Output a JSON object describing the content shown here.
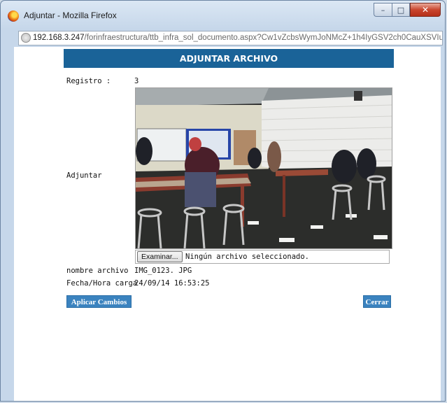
{
  "window": {
    "title": "Adjuntar - Mozilla Firefox",
    "controls": {
      "minimize": "–",
      "maximize": "□",
      "close": "✕"
    }
  },
  "addressbar": {
    "host": "192.168.3.247",
    "path": "/forinfraestructura/ttb_infra_sol_documento.aspx?Cw1vZcbsWymJoNMcZ+1h4IyGSV2ch0CauXSVIuV"
  },
  "page": {
    "header": "ADJUNTAR ARCHIVO",
    "registro_label": "Registro :",
    "registro_value": "3",
    "adjuntar_label": "Adjuntar",
    "file_button": "Examinar...",
    "file_status": "Ningún archivo seleccionado.",
    "nombre_label": "nombre archivo",
    "nombre_value": "IMG_0123. JPG",
    "fecha_label": "Fecha/Hora carga",
    "fecha_value": "24/09/14  16:53:25",
    "apply_button": "Aplicar Cambios",
    "close_button": "Cerrar"
  },
  "colors": {
    "header_bg": "#1a6398",
    "button_bg": "#3b83bf"
  },
  "icons": {
    "browser": "firefox-icon",
    "site": "globe-icon"
  }
}
